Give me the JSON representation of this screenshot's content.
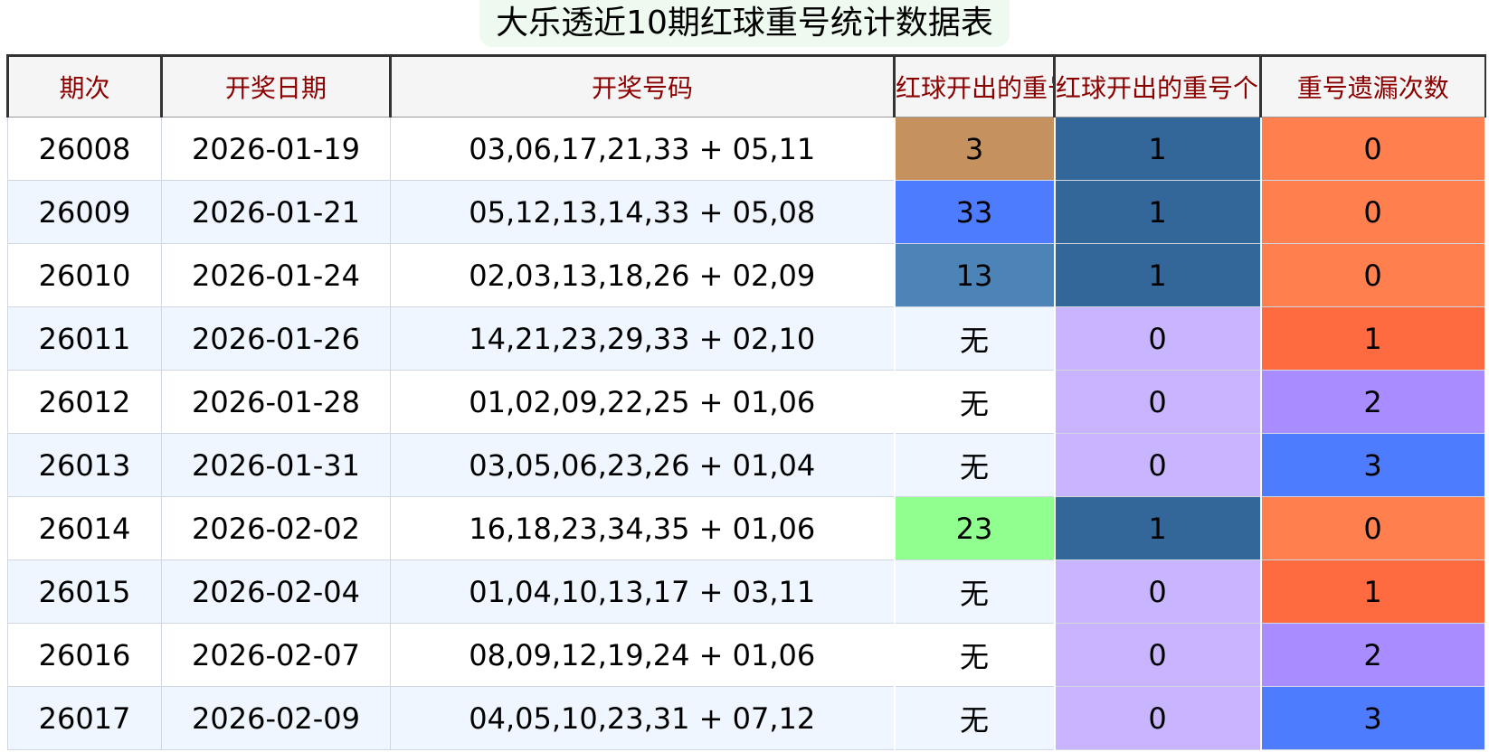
{
  "title": "大乐透近10期红球重号统计数据表",
  "headers": [
    "期次",
    "开奖日期",
    "开奖号码",
    "红球开出的重号",
    "红球开出的重号个数",
    "重号遗漏次数"
  ],
  "rows": [
    {
      "issue": "26008",
      "date": "2026-01-19",
      "numbers": "03,06,17,21,33 + 05,11",
      "repeat": "3",
      "count": "1",
      "miss": "0",
      "repeat_color": "#c4915f",
      "count_color": "#336699",
      "miss_color": "#ff7f4f"
    },
    {
      "issue": "26009",
      "date": "2026-01-21",
      "numbers": "05,12,13,14,33 + 05,08",
      "repeat": "33",
      "count": "1",
      "miss": "0",
      "repeat_color": "#4e7cff",
      "count_color": "#336699",
      "miss_color": "#ff7f4f"
    },
    {
      "issue": "26010",
      "date": "2026-01-24",
      "numbers": "02,03,13,18,26 + 02,09",
      "repeat": "13",
      "count": "1",
      "miss": "0",
      "repeat_color": "#4d84b8",
      "count_color": "#336699",
      "miss_color": "#ff7f4f"
    },
    {
      "issue": "26011",
      "date": "2026-01-26",
      "numbers": "14,21,23,29,33 + 02,10",
      "repeat": "无",
      "count": "0",
      "miss": "1",
      "repeat_color": "",
      "count_color": "#c8b4ff",
      "miss_color": "#ff6b41"
    },
    {
      "issue": "26012",
      "date": "2026-01-28",
      "numbers": "01,02,09,22,25 + 01,06",
      "repeat": "无",
      "count": "0",
      "miss": "2",
      "repeat_color": "",
      "count_color": "#c8b4ff",
      "miss_color": "#a98cff"
    },
    {
      "issue": "26013",
      "date": "2026-01-31",
      "numbers": "03,05,06,23,26 + 01,04",
      "repeat": "无",
      "count": "0",
      "miss": "3",
      "repeat_color": "",
      "count_color": "#c8b4ff",
      "miss_color": "#4e7cff"
    },
    {
      "issue": "26014",
      "date": "2026-02-02",
      "numbers": "16,18,23,34,35 + 01,06",
      "repeat": "23",
      "count": "1",
      "miss": "0",
      "repeat_color": "#90ff90",
      "count_color": "#336699",
      "miss_color": "#ff7f4f"
    },
    {
      "issue": "26015",
      "date": "2026-02-04",
      "numbers": "01,04,10,13,17 + 03,11",
      "repeat": "无",
      "count": "0",
      "miss": "1",
      "repeat_color": "",
      "count_color": "#c8b4ff",
      "miss_color": "#ff6b41"
    },
    {
      "issue": "26016",
      "date": "2026-02-07",
      "numbers": "08,09,12,19,24 + 01,06",
      "repeat": "无",
      "count": "0",
      "miss": "2",
      "repeat_color": "",
      "count_color": "#c8b4ff",
      "miss_color": "#a98cff"
    },
    {
      "issue": "26017",
      "date": "2026-02-09",
      "numbers": "04,05,10,23,31 + 07,12",
      "repeat": "无",
      "count": "0",
      "miss": "3",
      "repeat_color": "",
      "count_color": "#c8b4ff",
      "miss_color": "#4e7cff"
    }
  ]
}
